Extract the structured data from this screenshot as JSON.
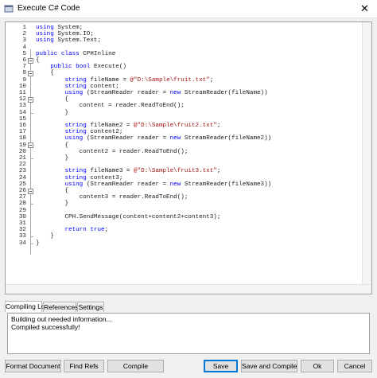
{
  "window": {
    "title": "Execute C# Code"
  },
  "editor": {
    "line_numbers": [
      "1",
      "2",
      "3",
      "4",
      "5",
      "6",
      "7",
      "8",
      "9",
      "10",
      "11",
      "12",
      "13",
      "14",
      "15",
      "16",
      "17",
      "18",
      "19",
      "20",
      "21",
      "22",
      "23",
      "24",
      "25",
      "26",
      "27",
      "28",
      "29",
      "30",
      "31",
      "32",
      "33",
      "34"
    ],
    "lines": [
      [
        {
          "t": "using ",
          "c": "kw"
        },
        {
          "t": "System;",
          "c": "pl"
        }
      ],
      [
        {
          "t": "using ",
          "c": "kw"
        },
        {
          "t": "System.IO;",
          "c": "pl"
        }
      ],
      [
        {
          "t": "using ",
          "c": "kw"
        },
        {
          "t": "System.Text;",
          "c": "pl"
        }
      ],
      [],
      [
        {
          "t": "public ",
          "c": "kw"
        },
        {
          "t": "class ",
          "c": "kw"
        },
        {
          "t": "CPHInline",
          "c": "pl"
        }
      ],
      [
        {
          "t": "{",
          "c": "pl"
        }
      ],
      [
        {
          "t": "    public ",
          "c": "kw"
        },
        {
          "t": "bool ",
          "c": "kw"
        },
        {
          "t": "Execute()",
          "c": "pl"
        }
      ],
      [
        {
          "t": "    {",
          "c": "pl"
        }
      ],
      [
        {
          "t": "        string ",
          "c": "kw"
        },
        {
          "t": "fileName = ",
          "c": "pl"
        },
        {
          "t": "@\"D:\\Sample\\fruit.txt\"",
          "c": "str"
        },
        {
          "t": ";",
          "c": "pl"
        }
      ],
      [
        {
          "t": "        string ",
          "c": "kw"
        },
        {
          "t": "content;",
          "c": "pl"
        }
      ],
      [
        {
          "t": "        using ",
          "c": "kw"
        },
        {
          "t": "(StreamReader reader = ",
          "c": "pl"
        },
        {
          "t": "new ",
          "c": "kw"
        },
        {
          "t": "StreamReader(fileName))",
          "c": "pl"
        }
      ],
      [
        {
          "t": "        {",
          "c": "pl"
        }
      ],
      [
        {
          "t": "            content = reader.ReadToEnd();",
          "c": "pl"
        }
      ],
      [
        {
          "t": "        }",
          "c": "pl"
        }
      ],
      [],
      [
        {
          "t": "        string ",
          "c": "kw"
        },
        {
          "t": "fileName2 = ",
          "c": "pl"
        },
        {
          "t": "@\"D:\\Sample\\fruit2.txt\"",
          "c": "str"
        },
        {
          "t": ";",
          "c": "pl"
        }
      ],
      [
        {
          "t": "        string ",
          "c": "kw"
        },
        {
          "t": "content2;",
          "c": "pl"
        }
      ],
      [
        {
          "t": "        using ",
          "c": "kw"
        },
        {
          "t": "(StreamReader reader = ",
          "c": "pl"
        },
        {
          "t": "new ",
          "c": "kw"
        },
        {
          "t": "StreamReader(fileName2))",
          "c": "pl"
        }
      ],
      [
        {
          "t": "        {",
          "c": "pl"
        }
      ],
      [
        {
          "t": "            content2 = reader.ReadToEnd();",
          "c": "pl"
        }
      ],
      [
        {
          "t": "        }",
          "c": "pl"
        }
      ],
      [],
      [
        {
          "t": "        string ",
          "c": "kw"
        },
        {
          "t": "fileName3 = ",
          "c": "pl"
        },
        {
          "t": "@\"D:\\Sample\\fruit3.txt\"",
          "c": "str"
        },
        {
          "t": ";",
          "c": "pl"
        }
      ],
      [
        {
          "t": "        string ",
          "c": "kw"
        },
        {
          "t": "content3;",
          "c": "pl"
        }
      ],
      [
        {
          "t": "        using ",
          "c": "kw"
        },
        {
          "t": "(StreamReader reader = ",
          "c": "pl"
        },
        {
          "t": "new ",
          "c": "kw"
        },
        {
          "t": "StreamReader(fileName3))",
          "c": "pl"
        }
      ],
      [
        {
          "t": "        {",
          "c": "pl"
        }
      ],
      [
        {
          "t": "            content3 = reader.ReadToEnd();",
          "c": "pl"
        }
      ],
      [
        {
          "t": "        }",
          "c": "pl"
        }
      ],
      [],
      [
        {
          "t": "        CPH.SendMessage(content+content2+content3);",
          "c": "pl"
        }
      ],
      [],
      [
        {
          "t": "        return ",
          "c": "kw"
        },
        {
          "t": "true",
          "c": "kw"
        },
        {
          "t": ";",
          "c": "pl"
        }
      ],
      [
        {
          "t": "    }",
          "c": "pl"
        }
      ],
      [
        {
          "t": "}",
          "c": "pl"
        }
      ]
    ]
  },
  "tabs": [
    {
      "label": "Compiling Log",
      "active": true
    },
    {
      "label": "References",
      "active": false
    },
    {
      "label": "Settings",
      "active": false
    }
  ],
  "log": {
    "lines": [
      "Building out needed information...",
      "Compiled successfully!"
    ]
  },
  "buttons": {
    "format_document": "Format Document",
    "find_refs": "Find Refs",
    "compile": "Compile",
    "save": "Save",
    "save_and_compile": "Save and Compile",
    "ok": "Ok",
    "cancel": "Cancel"
  },
  "colors": {
    "keyword": "#0000ff",
    "string": "#a31515",
    "accent": "#0078d7"
  },
  "icons": {
    "window": "app-icon",
    "close": "close-icon"
  }
}
